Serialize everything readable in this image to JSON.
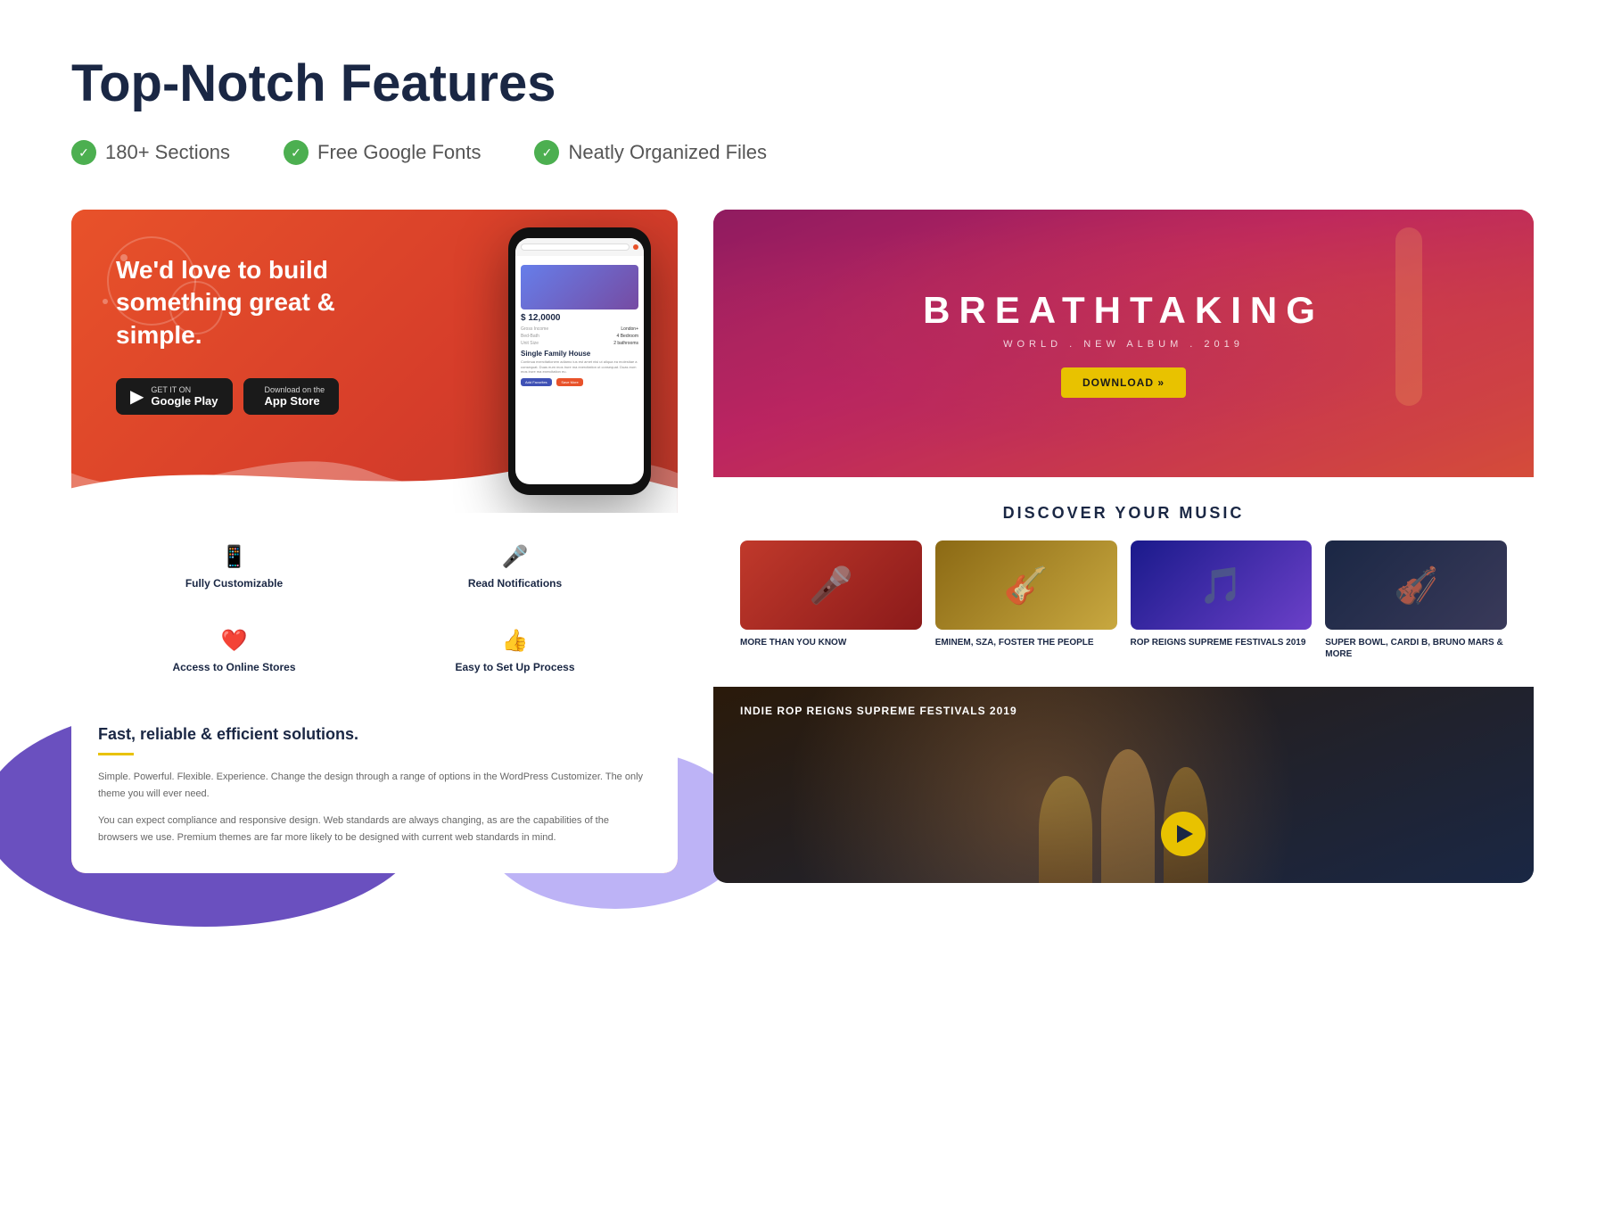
{
  "page": {
    "title": "Top-Notch Features",
    "features": [
      {
        "label": "180+ Sections"
      },
      {
        "label": "Free Google Fonts"
      },
      {
        "label": "Neatly Organized Files"
      }
    ]
  },
  "left_screenshot": {
    "hero_text": "We'd love to build something great & simple.",
    "store_btn_1_top": "GET IT ON",
    "store_btn_1_bottom": "Google Play",
    "store_btn_2_top": "Download on the",
    "store_btn_2_bottom": "App Store",
    "phone": {
      "amount": "$ 12,0000",
      "property_title": "Single Family House",
      "property_desc": "Continua exercitationem adiamo ius est amet nisi ut aliqua ea molestiae a consequat. Duas eum mos irure ma exercitation ut consequat. Duas eum mos irure ma exercitation eu."
    },
    "features": [
      {
        "icon": "📱",
        "title": "Fully Customizable",
        "color": "red"
      },
      {
        "icon": "🎤",
        "title": "Read Notifications",
        "color": "blue"
      },
      {
        "icon": "❤️",
        "title": "Access to Online Stores",
        "color": "red"
      },
      {
        "icon": "👍",
        "title": "Easy to Set Up Process",
        "color": "blue"
      }
    ],
    "desc_title": "Fast, reliable & efficient solutions.",
    "desc_text_1": "Simple. Powerful. Flexible. Experience. Change the design through a range of options in the WordPress Customizer. The only theme you will ever need.",
    "desc_text_2": "You can expect compliance and responsive design. Web standards are always changing, as are the capabilities of the browsers we use. Premium themes are far more likely to be designed with current web standards in mind."
  },
  "right_screenshot": {
    "hero_title": "BREATHTAKING",
    "hero_subtitle": "WORLD . NEW ALBUM . 2019",
    "download_btn": "DOWNLOAD »",
    "discover_title": "DISCOVER YOUR MUSIC",
    "music_items": [
      {
        "label": "MORE THAN YOU KNOW"
      },
      {
        "label": "EMINEM, SZA, FOSTER THE PEOPLE"
      },
      {
        "label": "ROP REIGNS SUPREME FESTIVALS 2019"
      },
      {
        "label": "SUPER BOWL, CARDI B, BRUNO MARS & MORE"
      }
    ],
    "video_label": "INDIE ROP REIGNS SUPREME FESTIVALS 2019"
  }
}
